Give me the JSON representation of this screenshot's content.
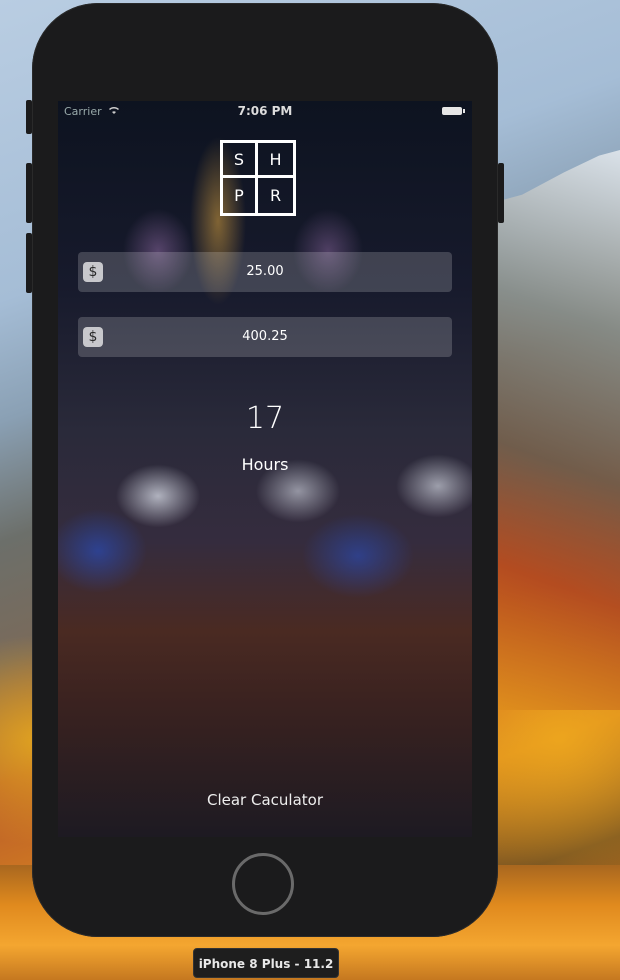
{
  "status_bar": {
    "carrier": "Carrier",
    "time": "7:06 PM"
  },
  "logo": {
    "letters": [
      "S",
      "H",
      "P",
      "R"
    ]
  },
  "fields": [
    {
      "currency_symbol": "$",
      "value": "25.00"
    },
    {
      "currency_symbol": "$",
      "value": "400.25"
    }
  ],
  "result": {
    "number": "17",
    "unit_label": "Hours"
  },
  "clear_button": {
    "label": "Clear Caculator"
  },
  "simulator": {
    "device_label": "iPhone 8 Plus - 11.2"
  },
  "icons": [
    "wifi-icon",
    "battery-icon",
    "dollar-icon",
    "home-button"
  ]
}
